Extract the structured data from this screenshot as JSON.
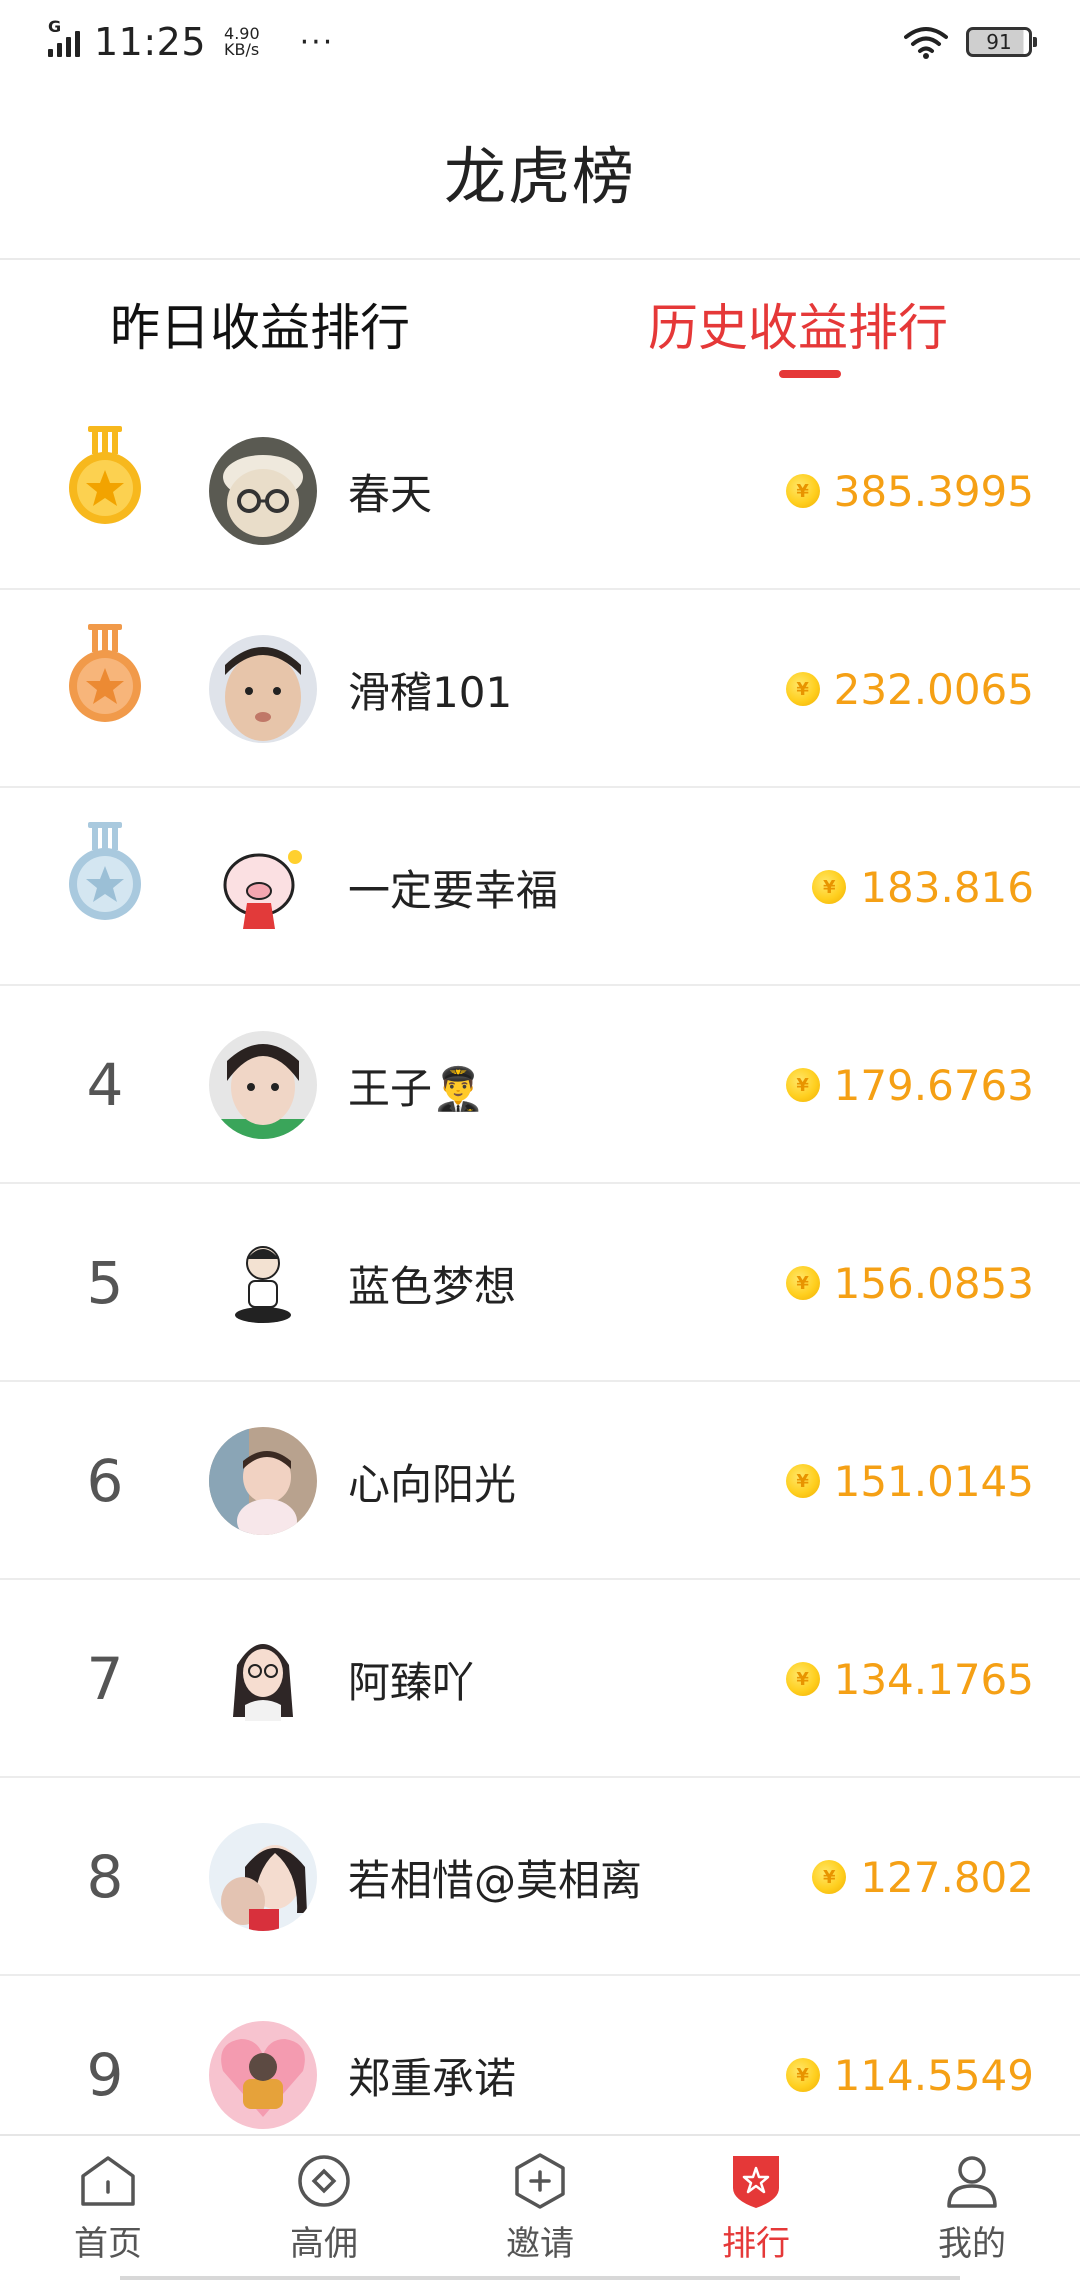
{
  "status_bar": {
    "network": "G",
    "time": "11:25",
    "speed_value": "4.90",
    "speed_unit": "KB/s",
    "more": "···",
    "battery": "91"
  },
  "header": {
    "title": "龙虎榜"
  },
  "tabs": [
    {
      "label": "昨日收益排行",
      "active": false
    },
    {
      "label": "历史收益排行",
      "active": true
    }
  ],
  "ranking": [
    {
      "rank": "1",
      "medal": "gold",
      "name": "春天",
      "score": "385.3995"
    },
    {
      "rank": "2",
      "medal": "bronze",
      "name": "滑稽101",
      "score": "232.0065"
    },
    {
      "rank": "3",
      "medal": "silver",
      "name": "一定要幸福",
      "score": "183.816"
    },
    {
      "rank": "4",
      "name": "王子👨‍✈️",
      "score": "179.6763"
    },
    {
      "rank": "5",
      "name": "蓝色梦想",
      "score": "156.0853"
    },
    {
      "rank": "6",
      "name": "心向阳光",
      "score": "151.0145"
    },
    {
      "rank": "7",
      "name": "阿臻吖",
      "score": "134.1765"
    },
    {
      "rank": "8",
      "name": "若相惜@莫相离",
      "score": "127.802"
    },
    {
      "rank": "9",
      "name": "郑重承诺",
      "score": "114.5549"
    }
  ],
  "coin_symbol": "¥",
  "bottom_nav": [
    {
      "label": "首页",
      "icon": "home-icon",
      "active": false
    },
    {
      "label": "高佣",
      "icon": "commission-icon",
      "active": false
    },
    {
      "label": "邀请",
      "icon": "invite-icon",
      "active": false
    },
    {
      "label": "排行",
      "icon": "ranking-icon",
      "active": true
    },
    {
      "label": "我的",
      "icon": "profile-icon",
      "active": false
    }
  ],
  "colors": {
    "accent": "#e53838",
    "score": "#f5a015",
    "gold": "#f7b81d",
    "bronze": "#f19a4a",
    "silver": "#a9c9de"
  }
}
